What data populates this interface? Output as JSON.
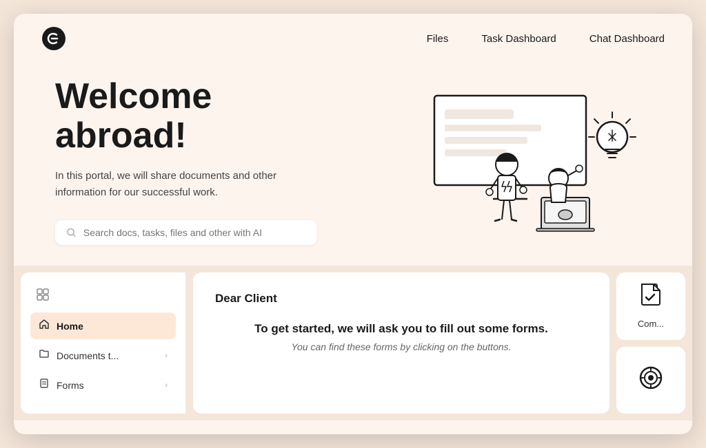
{
  "brand": {
    "logo_alt": "Craft logo"
  },
  "navbar": {
    "links": [
      {
        "id": "files",
        "label": "Files"
      },
      {
        "id": "task-dashboard",
        "label": "Task Dashboard"
      },
      {
        "id": "chat-dashboard",
        "label": "Chat Dashboard"
      }
    ]
  },
  "hero": {
    "title": "Welcome abroad!",
    "subtitle": "In this portal, we will share documents and other information for our successful work.",
    "search_placeholder": "Search docs, tasks, files and other with AI"
  },
  "sidebar": {
    "top_icon": "⊟",
    "items": [
      {
        "id": "home",
        "label": "Home",
        "icon": "⌂",
        "active": true
      },
      {
        "id": "documents",
        "label": "Documents t...",
        "icon": "☐",
        "has_chevron": true
      },
      {
        "id": "forms",
        "label": "Forms",
        "icon": "☐",
        "has_chevron": true
      }
    ]
  },
  "main": {
    "title": "Dear Client",
    "body": "To get started, we will ask you to fill out some forms.",
    "sub": "You can find these forms by clicking on the buttons."
  },
  "right_panel": {
    "cards": [
      {
        "id": "complete",
        "icon": "📄",
        "label": "Com..."
      },
      {
        "id": "goal",
        "icon": "🎯",
        "label": ""
      }
    ]
  }
}
